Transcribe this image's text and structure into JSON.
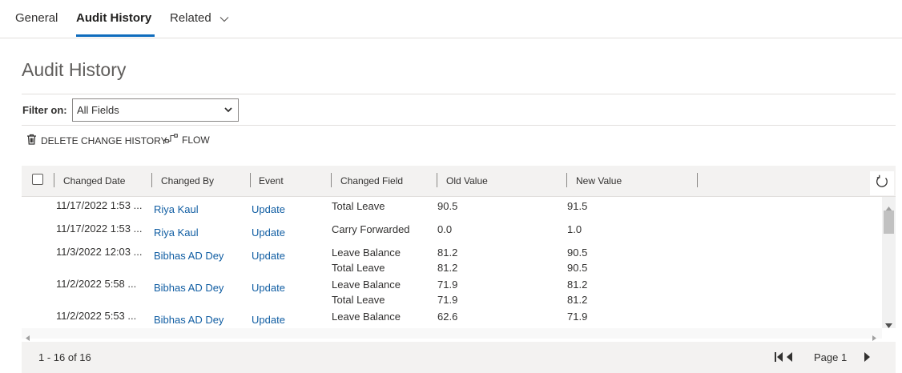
{
  "tabs": [
    {
      "label": "General"
    },
    {
      "label": "Audit History"
    },
    {
      "label": "Related"
    }
  ],
  "page_title": "Audit History",
  "filter": {
    "label": "Filter on:",
    "value": "All Fields"
  },
  "commands": {
    "delete_label": "DELETE CHANGE HISTORY",
    "flow_label": "FLOW"
  },
  "columns": [
    "Changed Date",
    "Changed By",
    "Event",
    "Changed Field",
    "Old Value",
    "New Value"
  ],
  "rows": [
    {
      "date": "11/17/2022 1:53 ...",
      "by": "Riya Kaul",
      "event": "Update",
      "changes": [
        {
          "field": "Total Leave",
          "old": "90.5",
          "new": "91.5"
        }
      ]
    },
    {
      "date": "11/17/2022 1:53 ...",
      "by": "Riya Kaul",
      "event": "Update",
      "changes": [
        {
          "field": "Carry Forwarded",
          "old": "0.0",
          "new": "1.0"
        }
      ]
    },
    {
      "date": "11/3/2022 12:03 ...",
      "by": "Bibhas AD Dey",
      "event": "Update",
      "changes": [
        {
          "field": "Leave Balance",
          "old": "81.2",
          "new": "90.5"
        },
        {
          "field": "Total Leave",
          "old": "81.2",
          "new": "90.5"
        }
      ]
    },
    {
      "date": "11/2/2022 5:58 ...",
      "by": "Bibhas AD Dey",
      "event": "Update",
      "changes": [
        {
          "field": "Leave Balance",
          "old": "71.9",
          "new": "81.2"
        },
        {
          "field": "Total Leave",
          "old": "71.9",
          "new": "81.2"
        }
      ]
    },
    {
      "date": "11/2/2022 5:53 ...",
      "by": "Bibhas AD Dey",
      "event": "Update",
      "changes": [
        {
          "field": "Leave Balance",
          "old": "62.6",
          "new": "71.9"
        }
      ]
    }
  ],
  "footer": {
    "count": "1 - 16 of 16",
    "page_label": "Page 1"
  },
  "colors": {
    "accent": "#0f6cbd",
    "link": "#115ea3",
    "header_bg": "#f3f2f1"
  }
}
